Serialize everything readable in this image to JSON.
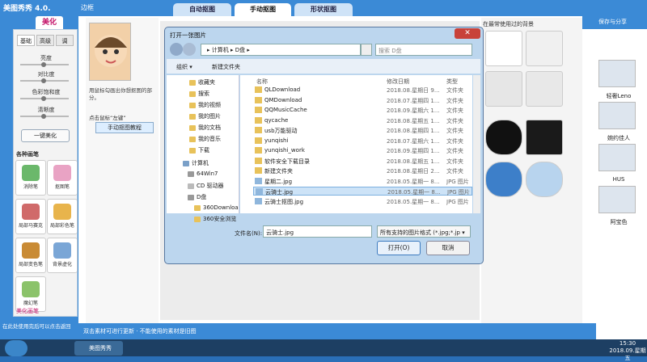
{
  "app": {
    "title": "美图秀秀 4.0.",
    "beautify_tab": "美化",
    "subtabs": [
      "基础",
      "高级",
      "调"
    ],
    "sliders": [
      "亮度",
      "对比度",
      "色彩饱和度",
      "清晰度"
    ],
    "one_key_button": "一键美化",
    "effects_header": "各种画笔",
    "tools": [
      "消除笔",
      "抠图笔",
      "局部马赛克",
      "局部彩色笔",
      "局部变色笔",
      "背景虚化",
      "魔幻笔"
    ],
    "extra_label": "美化画笔"
  },
  "frame_tabs": [
    "边框",
    "自动抠图",
    "手动抠图",
    "形状抠图"
  ],
  "options": {
    "hint": "用鼠标勾画出你想抠图的部分。",
    "mouse_hint": "点击鼠标“左键”",
    "manual_draw_button": "手动抠图教程"
  },
  "right_panel": {
    "recent_label": "在最常使用过的背景",
    "save_share": "保存与分享",
    "labels": [
      "轻奢Leno",
      "婉约佳人",
      "HUS",
      "阿宝色"
    ]
  },
  "status": {
    "left": "在此处使用完后可以点击返回",
    "main": "双击素材可进行更新 · 不能使用的素材是旧图"
  },
  "taskbar": {
    "app_item": "美图秀秀",
    "time": "15:30",
    "date": "2018.09.星期五"
  },
  "dialog": {
    "title": "打开一张图片",
    "address": "▸ 计算机 ▸ D盘 ▸",
    "search_placeholder": "搜索 D盘",
    "organize": "组织 ▾",
    "new_folder": "新建文件夹",
    "tree": [
      "收藏夹",
      "搜索",
      "我的视频",
      "我的图片",
      "我的文档",
      "我的音乐",
      "下载",
      "计算机",
      "64Win7",
      "CD 驱动器",
      "D盘",
      "360Downloa",
      "360安全浏览"
    ],
    "columns": [
      "名称",
      "修改日期",
      "类型"
    ],
    "files": [
      {
        "name": "QLDownload",
        "date": "2018.08.星期日 9...",
        "type": "文件夹"
      },
      {
        "name": "QMDownload",
        "date": "2018.07.星期四 1...",
        "type": "文件夹"
      },
      {
        "name": "QQMusicCache",
        "date": "2018.09.星期六 1...",
        "type": "文件夹"
      },
      {
        "name": "qycache",
        "date": "2018.08.星期五 1...",
        "type": "文件夹"
      },
      {
        "name": "usb万能驱动",
        "date": "2018.08.星期四 1...",
        "type": "文件夹"
      },
      {
        "name": "yunqishi",
        "date": "2018.07.星期六 1...",
        "type": "文件夹"
      },
      {
        "name": "yunqishi_work",
        "date": "2018.09.星期四 1...",
        "type": "文件夹"
      },
      {
        "name": "软件安全下载目录",
        "date": "2018.08.星期五 1...",
        "type": "文件夹"
      },
      {
        "name": "新建文件夹",
        "date": "2018.08.星期日 2...",
        "type": "文件夹"
      },
      {
        "name": "星期二.jpg",
        "date": "2018.05.星期一 8...",
        "type": "JPG 图片"
      },
      {
        "name": "云骑士.jpg",
        "date": "2018.05.星期一 8...",
        "type": "JPG 图片"
      },
      {
        "name": "云骑士抠图.jpg",
        "date": "2018.05.星期一 8...",
        "type": "JPG 图片"
      }
    ],
    "filename_label": "文件名(N):",
    "filename_value": "云骑士.jpg",
    "filetype": "所有支持的图片格式 (*.jpg;*.jp ▾",
    "open_button": "打开(O)",
    "cancel_button": "取消"
  },
  "colors": {
    "title_blue": "#3b8ad6",
    "close_red": "#c8423a",
    "selection": "#cde3f7"
  }
}
